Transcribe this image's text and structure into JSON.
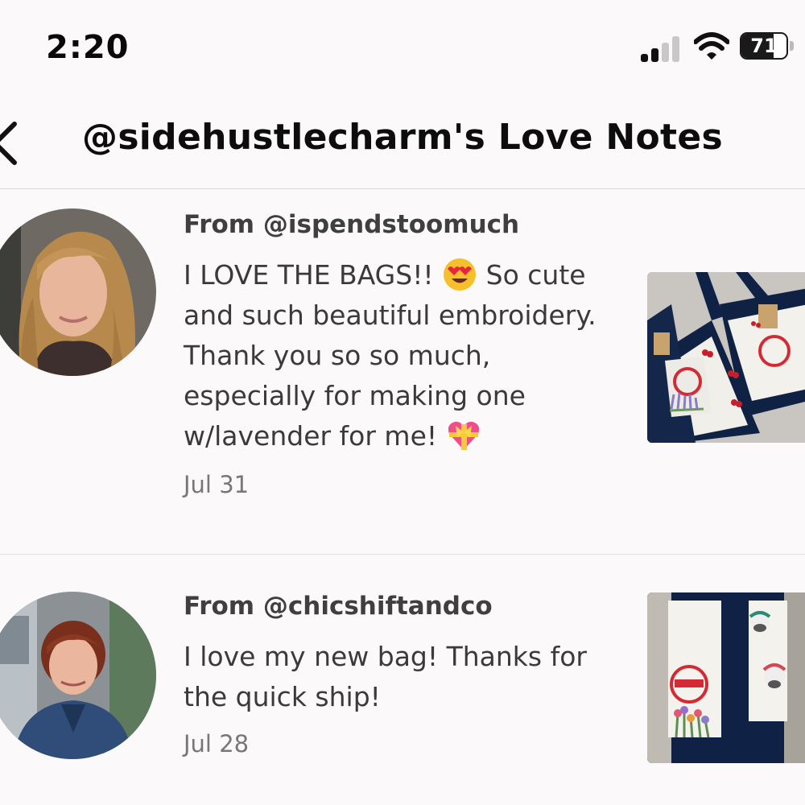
{
  "status": {
    "time": "2:20",
    "battery": "71",
    "battery_level": 0.71
  },
  "header": {
    "title": "@sidehustlecharm's Love Notes",
    "back_icon": "chevron-left-icon"
  },
  "notes": [
    {
      "from": "From @ispendstoomuch",
      "message_parts": [
        "I LOVE THE BAGS!! ",
        " So cute and such beautiful embroidery. Thank you so so much, especially for making one w/lavender for me! "
      ],
      "emojis": [
        "heart-eyes-emoji",
        "heart-with-ribbon-emoji"
      ],
      "date": "Jul 31"
    },
    {
      "from": "From @chicshiftandco",
      "message": "I love my new bag! Thanks for the quick ship!",
      "date": "Jul 28"
    }
  ],
  "colors": {
    "background": "#fbf9fa",
    "navy": "#0f2145",
    "trader_red": "#d32b35"
  }
}
